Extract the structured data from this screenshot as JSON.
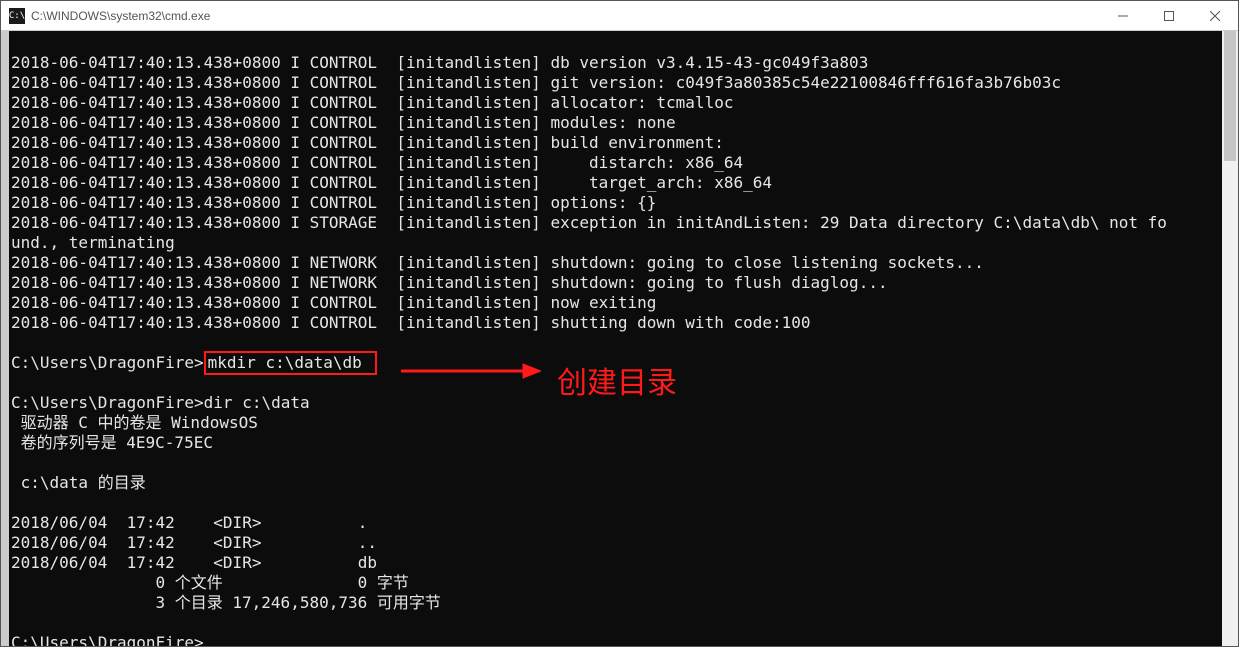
{
  "window": {
    "title": "C:\\WINDOWS\\system32\\cmd.exe",
    "icon_text": "C:\\"
  },
  "log": {
    "l0": "2018-06-04T17:40:13.438+0800 I CONTROL  [initandlisten] db version v3.4.15-43-gc049f3a803",
    "l1": "2018-06-04T17:40:13.438+0800 I CONTROL  [initandlisten] git version: c049f3a80385c54e22100846fff616fa3b76b03c",
    "l2": "2018-06-04T17:40:13.438+0800 I CONTROL  [initandlisten] allocator: tcmalloc",
    "l3": "2018-06-04T17:40:13.438+0800 I CONTROL  [initandlisten] modules: none",
    "l4": "2018-06-04T17:40:13.438+0800 I CONTROL  [initandlisten] build environment:",
    "l5": "2018-06-04T17:40:13.438+0800 I CONTROL  [initandlisten]     distarch: x86_64",
    "l6": "2018-06-04T17:40:13.438+0800 I CONTROL  [initandlisten]     target_arch: x86_64",
    "l7": "2018-06-04T17:40:13.438+0800 I CONTROL  [initandlisten] options: {}",
    "l8": "2018-06-04T17:40:13.438+0800 I STORAGE  [initandlisten] exception in initAndListen: 29 Data directory C:\\data\\db\\ not fo",
    "l9": "und., terminating",
    "l10": "2018-06-04T17:40:13.438+0800 I NETWORK  [initandlisten] shutdown: going to close listening sockets...",
    "l11": "2018-06-04T17:40:13.438+0800 I NETWORK  [initandlisten] shutdown: going to flush diaglog...",
    "l12": "2018-06-04T17:40:13.438+0800 I CONTROL  [initandlisten] now exiting",
    "l13": "2018-06-04T17:40:13.438+0800 I CONTROL  [initandlisten] shutting down with code:100"
  },
  "prompt1": {
    "prefix": "C:\\Users\\DragonFire>",
    "command": "mkdir c:\\data\\db "
  },
  "prompt2": {
    "prefix": "C:\\Users\\DragonFire>",
    "command": "dir c:\\data"
  },
  "dirout": {
    "l0": " 驱动器 C 中的卷是 WindowsOS",
    "l1": " 卷的序列号是 4E9C-75EC",
    "l2": "",
    "l3": " c:\\data 的目录",
    "l4": "",
    "l5": "2018/06/04  17:42    <DIR>          .",
    "l6": "2018/06/04  17:42    <DIR>          ..",
    "l7": "2018/06/04  17:42    <DIR>          db",
    "l8": "               0 个文件              0 字节",
    "l9": "               3 个目录 17,246,580,736 可用字节"
  },
  "prompt3": {
    "prefix": "C:\\Users\\DragonFire>"
  },
  "annotation": {
    "label": "创建目录"
  }
}
